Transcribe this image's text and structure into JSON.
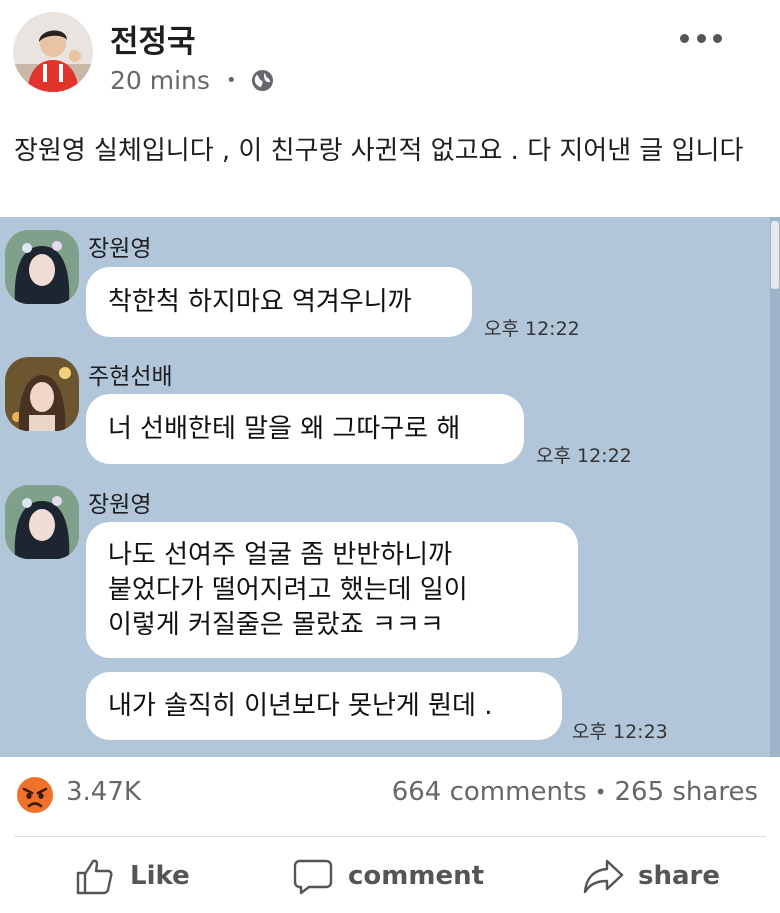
{
  "post": {
    "author_name": "전정국",
    "time": "20 mins",
    "separator": "•",
    "text": "장원영 실체입니다 , 이 친구랑 사귄적 없고요 . 다 지어낸 글 입니다"
  },
  "chat": {
    "messages": [
      {
        "sender": "장원영",
        "lines": [
          "착한척 하지마요 역겨우니까"
        ],
        "time": "오후 12:22"
      },
      {
        "sender": "주현선배",
        "lines": [
          "너 선배한테 말을 왜 그따구로 해"
        ],
        "time": "오후 12:22"
      },
      {
        "sender": "장원영",
        "lines": [
          "나도 선여주 얼굴 좀 반반하니까",
          "붙었다가 떨어지려고 했는데 일이",
          "이렇게 커질줄은 몰랐죠 ㅋㅋㅋ"
        ],
        "time": ""
      },
      {
        "sender": "",
        "lines": [
          "내가 솔직히 이년보다 못난게 뭔데 ."
        ],
        "time": "오후 12:23"
      }
    ]
  },
  "stats": {
    "reaction_icon": "angry-emoji-icon",
    "reaction_count": "3.47K",
    "comments": "664 comments",
    "separator": "•",
    "shares": "265 shares"
  },
  "actions": {
    "like": "Like",
    "comment": "comment",
    "share": "share"
  },
  "colors": {
    "chat_background": "#b2c6da",
    "angry_emoji": "#f0712a",
    "secondary_text": "#65676b"
  }
}
